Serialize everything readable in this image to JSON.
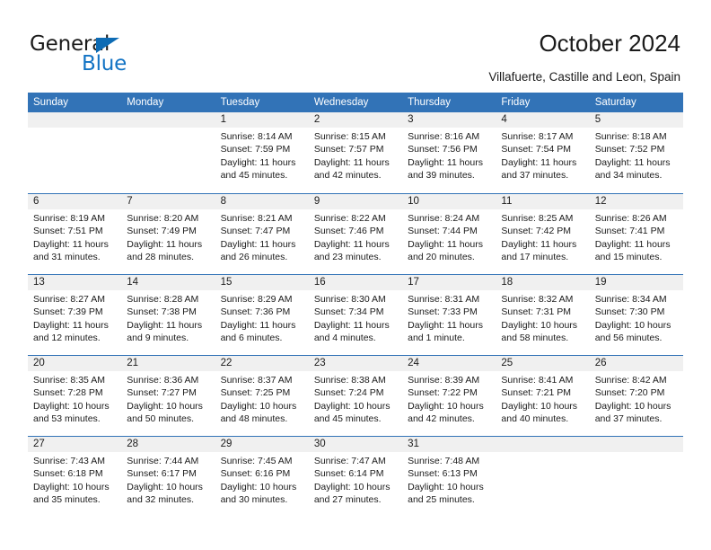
{
  "logo": {
    "word_top": "General",
    "word_bottom": "Blue",
    "triangle_color": "#0d6bb4",
    "text_color": "#1273c4"
  },
  "header": {
    "title": "October 2024",
    "subtitle": "Villafuerte, Castille and Leon, Spain",
    "accent_color": "#3273b7"
  },
  "calendar": {
    "weekdays": [
      "Sunday",
      "Monday",
      "Tuesday",
      "Wednesday",
      "Thursday",
      "Friday",
      "Saturday"
    ],
    "weeks": [
      [
        {
          "day": "",
          "sunrise": "",
          "sunset": "",
          "daylight": "",
          "empty": true
        },
        {
          "day": "",
          "sunrise": "",
          "sunset": "",
          "daylight": "",
          "empty": true
        },
        {
          "day": "1",
          "sunrise": "Sunrise: 8:14 AM",
          "sunset": "Sunset: 7:59 PM",
          "daylight": "Daylight: 11 hours and 45 minutes."
        },
        {
          "day": "2",
          "sunrise": "Sunrise: 8:15 AM",
          "sunset": "Sunset: 7:57 PM",
          "daylight": "Daylight: 11 hours and 42 minutes."
        },
        {
          "day": "3",
          "sunrise": "Sunrise: 8:16 AM",
          "sunset": "Sunset: 7:56 PM",
          "daylight": "Daylight: 11 hours and 39 minutes."
        },
        {
          "day": "4",
          "sunrise": "Sunrise: 8:17 AM",
          "sunset": "Sunset: 7:54 PM",
          "daylight": "Daylight: 11 hours and 37 minutes."
        },
        {
          "day": "5",
          "sunrise": "Sunrise: 8:18 AM",
          "sunset": "Sunset: 7:52 PM",
          "daylight": "Daylight: 11 hours and 34 minutes."
        }
      ],
      [
        {
          "day": "6",
          "sunrise": "Sunrise: 8:19 AM",
          "sunset": "Sunset: 7:51 PM",
          "daylight": "Daylight: 11 hours and 31 minutes."
        },
        {
          "day": "7",
          "sunrise": "Sunrise: 8:20 AM",
          "sunset": "Sunset: 7:49 PM",
          "daylight": "Daylight: 11 hours and 28 minutes."
        },
        {
          "day": "8",
          "sunrise": "Sunrise: 8:21 AM",
          "sunset": "Sunset: 7:47 PM",
          "daylight": "Daylight: 11 hours and 26 minutes."
        },
        {
          "day": "9",
          "sunrise": "Sunrise: 8:22 AM",
          "sunset": "Sunset: 7:46 PM",
          "daylight": "Daylight: 11 hours and 23 minutes."
        },
        {
          "day": "10",
          "sunrise": "Sunrise: 8:24 AM",
          "sunset": "Sunset: 7:44 PM",
          "daylight": "Daylight: 11 hours and 20 minutes."
        },
        {
          "day": "11",
          "sunrise": "Sunrise: 8:25 AM",
          "sunset": "Sunset: 7:42 PM",
          "daylight": "Daylight: 11 hours and 17 minutes."
        },
        {
          "day": "12",
          "sunrise": "Sunrise: 8:26 AM",
          "sunset": "Sunset: 7:41 PM",
          "daylight": "Daylight: 11 hours and 15 minutes."
        }
      ],
      [
        {
          "day": "13",
          "sunrise": "Sunrise: 8:27 AM",
          "sunset": "Sunset: 7:39 PM",
          "daylight": "Daylight: 11 hours and 12 minutes."
        },
        {
          "day": "14",
          "sunrise": "Sunrise: 8:28 AM",
          "sunset": "Sunset: 7:38 PM",
          "daylight": "Daylight: 11 hours and 9 minutes."
        },
        {
          "day": "15",
          "sunrise": "Sunrise: 8:29 AM",
          "sunset": "Sunset: 7:36 PM",
          "daylight": "Daylight: 11 hours and 6 minutes."
        },
        {
          "day": "16",
          "sunrise": "Sunrise: 8:30 AM",
          "sunset": "Sunset: 7:34 PM",
          "daylight": "Daylight: 11 hours and 4 minutes."
        },
        {
          "day": "17",
          "sunrise": "Sunrise: 8:31 AM",
          "sunset": "Sunset: 7:33 PM",
          "daylight": "Daylight: 11 hours and 1 minute."
        },
        {
          "day": "18",
          "sunrise": "Sunrise: 8:32 AM",
          "sunset": "Sunset: 7:31 PM",
          "daylight": "Daylight: 10 hours and 58 minutes."
        },
        {
          "day": "19",
          "sunrise": "Sunrise: 8:34 AM",
          "sunset": "Sunset: 7:30 PM",
          "daylight": "Daylight: 10 hours and 56 minutes."
        }
      ],
      [
        {
          "day": "20",
          "sunrise": "Sunrise: 8:35 AM",
          "sunset": "Sunset: 7:28 PM",
          "daylight": "Daylight: 10 hours and 53 minutes."
        },
        {
          "day": "21",
          "sunrise": "Sunrise: 8:36 AM",
          "sunset": "Sunset: 7:27 PM",
          "daylight": "Daylight: 10 hours and 50 minutes."
        },
        {
          "day": "22",
          "sunrise": "Sunrise: 8:37 AM",
          "sunset": "Sunset: 7:25 PM",
          "daylight": "Daylight: 10 hours and 48 minutes."
        },
        {
          "day": "23",
          "sunrise": "Sunrise: 8:38 AM",
          "sunset": "Sunset: 7:24 PM",
          "daylight": "Daylight: 10 hours and 45 minutes."
        },
        {
          "day": "24",
          "sunrise": "Sunrise: 8:39 AM",
          "sunset": "Sunset: 7:22 PM",
          "daylight": "Daylight: 10 hours and 42 minutes."
        },
        {
          "day": "25",
          "sunrise": "Sunrise: 8:41 AM",
          "sunset": "Sunset: 7:21 PM",
          "daylight": "Daylight: 10 hours and 40 minutes."
        },
        {
          "day": "26",
          "sunrise": "Sunrise: 8:42 AM",
          "sunset": "Sunset: 7:20 PM",
          "daylight": "Daylight: 10 hours and 37 minutes."
        }
      ],
      [
        {
          "day": "27",
          "sunrise": "Sunrise: 7:43 AM",
          "sunset": "Sunset: 6:18 PM",
          "daylight": "Daylight: 10 hours and 35 minutes."
        },
        {
          "day": "28",
          "sunrise": "Sunrise: 7:44 AM",
          "sunset": "Sunset: 6:17 PM",
          "daylight": "Daylight: 10 hours and 32 minutes."
        },
        {
          "day": "29",
          "sunrise": "Sunrise: 7:45 AM",
          "sunset": "Sunset: 6:16 PM",
          "daylight": "Daylight: 10 hours and 30 minutes."
        },
        {
          "day": "30",
          "sunrise": "Sunrise: 7:47 AM",
          "sunset": "Sunset: 6:14 PM",
          "daylight": "Daylight: 10 hours and 27 minutes."
        },
        {
          "day": "31",
          "sunrise": "Sunrise: 7:48 AM",
          "sunset": "Sunset: 6:13 PM",
          "daylight": "Daylight: 10 hours and 25 minutes."
        },
        {
          "day": "",
          "sunrise": "",
          "sunset": "",
          "daylight": "",
          "empty": true
        },
        {
          "day": "",
          "sunrise": "",
          "sunset": "",
          "daylight": "",
          "empty": true
        }
      ]
    ]
  }
}
